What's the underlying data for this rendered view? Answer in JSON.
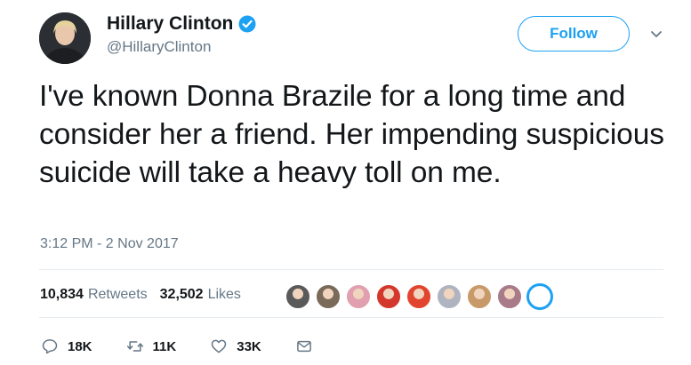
{
  "author": {
    "name": "Hillary Clinton",
    "handle": "@HillaryClinton",
    "verified": true
  },
  "follow_label": "Follow",
  "tweet": {
    "text": "I've known Donna Brazile for a long time and consider her a friend. Her impending suspicious suicide will take a heavy toll on me.",
    "timestamp": "3:12 PM - 2 Nov 2017"
  },
  "stats": {
    "retweets_count": "10,834",
    "retweets_label": "Retweets",
    "likes_count": "32,502",
    "likes_label": "Likes"
  },
  "likers": [
    {
      "icon": "avatar-person",
      "color": "#5a5a5a"
    },
    {
      "icon": "avatar-group",
      "color": "#7a6a5a"
    },
    {
      "icon": "avatar-person",
      "color": "#e0a0b0"
    },
    {
      "icon": "avatar-logo",
      "color": "#d4372c"
    },
    {
      "icon": "avatar-logo",
      "color": "#e2452f"
    },
    {
      "icon": "avatar-person",
      "color": "#b0b4c0"
    },
    {
      "icon": "avatar-person",
      "color": "#c89a6a"
    },
    {
      "icon": "avatar-person",
      "color": "#a87a8a"
    },
    {
      "icon": "avatar-logo",
      "color": "#1da1f2"
    }
  ],
  "actions": {
    "replies": "18K",
    "retweets": "11K",
    "likes": "33K"
  },
  "colors": {
    "accent": "#1da1f2",
    "text": "#14171a",
    "secondary": "#657786",
    "border": "#e6ecf0"
  }
}
